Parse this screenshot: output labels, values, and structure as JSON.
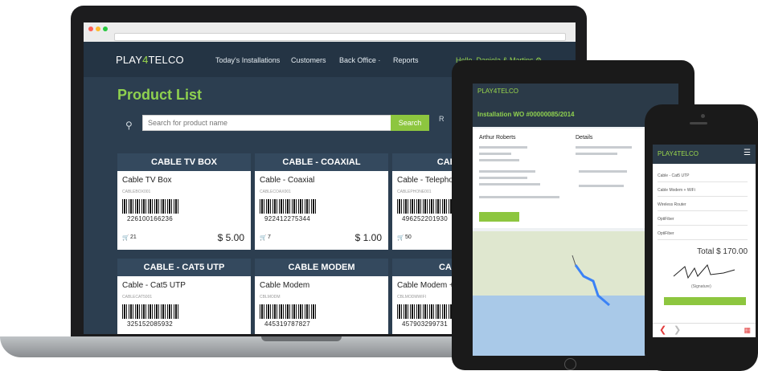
{
  "laptop": {
    "logo": {
      "prefix": "PLAY",
      "number": "4",
      "suffix": "TELCO"
    },
    "nav": [
      "Today's Installations",
      "Customers",
      "Back Office ·",
      "Reports"
    ],
    "user": "Hello, Daniela & Martins ⚙",
    "page_title": "Product List",
    "search": {
      "placeholder": "Search for product name",
      "button": "Search",
      "reset": "R"
    },
    "cards": [
      {
        "header": "CABLE TV BOX",
        "name": "Cable TV Box",
        "code": "CABLEBOX001",
        "barcode": "226100166236",
        "stock": "21",
        "price": "$ 5.00"
      },
      {
        "header": "CABLE - COAXIAL",
        "name": "Cable - Coaxial",
        "code": "CABLECOAX001",
        "barcode": "922412275344",
        "stock": "7",
        "price": "$ 1.00"
      },
      {
        "header": "CABLE - T",
        "name": "Cable - Telephone",
        "code": "CABLEPHONE001",
        "barcode": "496252201930",
        "stock": "50",
        "price": ""
      },
      {
        "header": "CABLE - CAT5 UTP",
        "name": "Cable - Cat5 UTP",
        "code": "CABLECAT5001",
        "barcode": "325152085932",
        "stock": "",
        "price": ""
      },
      {
        "header": "CABLE MODEM",
        "name": "Cable Modem",
        "code": "CBLMODM",
        "barcode": "445319787827",
        "stock": "",
        "price": ""
      },
      {
        "header": "CABLE M",
        "name": "Cable Modem +",
        "code": "CBLMODMWIFI",
        "barcode": "457903299731",
        "stock": "",
        "price": ""
      }
    ]
  },
  "tablet": {
    "logo": "PLAY4TELCO",
    "title": "Installation WO #00000085/2014",
    "customer": "Arthur Roberts",
    "details": "Details"
  },
  "phone": {
    "logo": "PLAY4TELCO",
    "menu_icon": "☰",
    "items": [
      "Cable - Cat5 UTP",
      "Cable Modem + WiFi",
      "Wireless Router",
      "OptiFiber",
      "OptiFiber"
    ],
    "total": "Total $ 170.00",
    "signature_label": "(Signature)",
    "back_icon": "❮",
    "forward_icon": "❯",
    "grid_icon": "▦"
  }
}
